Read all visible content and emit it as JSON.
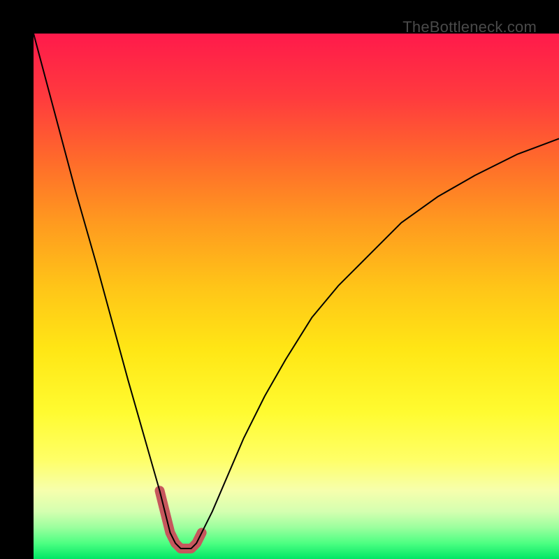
{
  "watermark": "TheBottleneck.com",
  "chart_data": {
    "type": "line",
    "title": "",
    "xlabel": "",
    "ylabel": "",
    "xlim": [
      0,
      100
    ],
    "ylim": [
      0,
      100
    ],
    "grid": false,
    "legend": false,
    "series": [
      {
        "name": "bottleneck-curve",
        "x": [
          0,
          4,
          8,
          12,
          15,
          18,
          20,
          22,
          24,
          25,
          26,
          27,
          28,
          29,
          30,
          31,
          32,
          34,
          37,
          40,
          44,
          48,
          53,
          58,
          64,
          70,
          77,
          84,
          92,
          100
        ],
        "values": [
          100,
          85,
          70,
          56,
          45,
          34,
          27,
          20,
          13,
          9,
          5,
          3,
          2,
          2,
          2,
          3,
          5,
          9,
          16,
          23,
          31,
          38,
          46,
          52,
          58,
          64,
          69,
          73,
          77,
          80
        ]
      },
      {
        "name": "highlight-segment",
        "x": [
          24,
          25,
          26,
          27,
          28,
          29,
          30,
          31,
          32
        ],
        "values": [
          13,
          9,
          5,
          3,
          2,
          2,
          2,
          3,
          5
        ]
      }
    ],
    "gradient_bands": [
      {
        "y": 100,
        "color": "#ff1a4b"
      },
      {
        "y": 88,
        "color": "#ff3a3e"
      },
      {
        "y": 76,
        "color": "#ff6a2b"
      },
      {
        "y": 64,
        "color": "#ff9a1f"
      },
      {
        "y": 52,
        "color": "#ffc418"
      },
      {
        "y": 40,
        "color": "#ffe615"
      },
      {
        "y": 28,
        "color": "#fffb30"
      },
      {
        "y": 19,
        "color": "#ffff66"
      },
      {
        "y": 13,
        "color": "#f6ffad"
      },
      {
        "y": 9,
        "color": "#d4ffb0"
      },
      {
        "y": 6,
        "color": "#9bff9e"
      },
      {
        "y": 3,
        "color": "#4dff82"
      },
      {
        "y": 0,
        "color": "#00e765"
      }
    ],
    "highlight_style": {
      "stroke": "#c6575d",
      "stroke_width": 14,
      "linecap": "round"
    },
    "curve_style": {
      "stroke": "#000000",
      "stroke_width": 2
    }
  }
}
